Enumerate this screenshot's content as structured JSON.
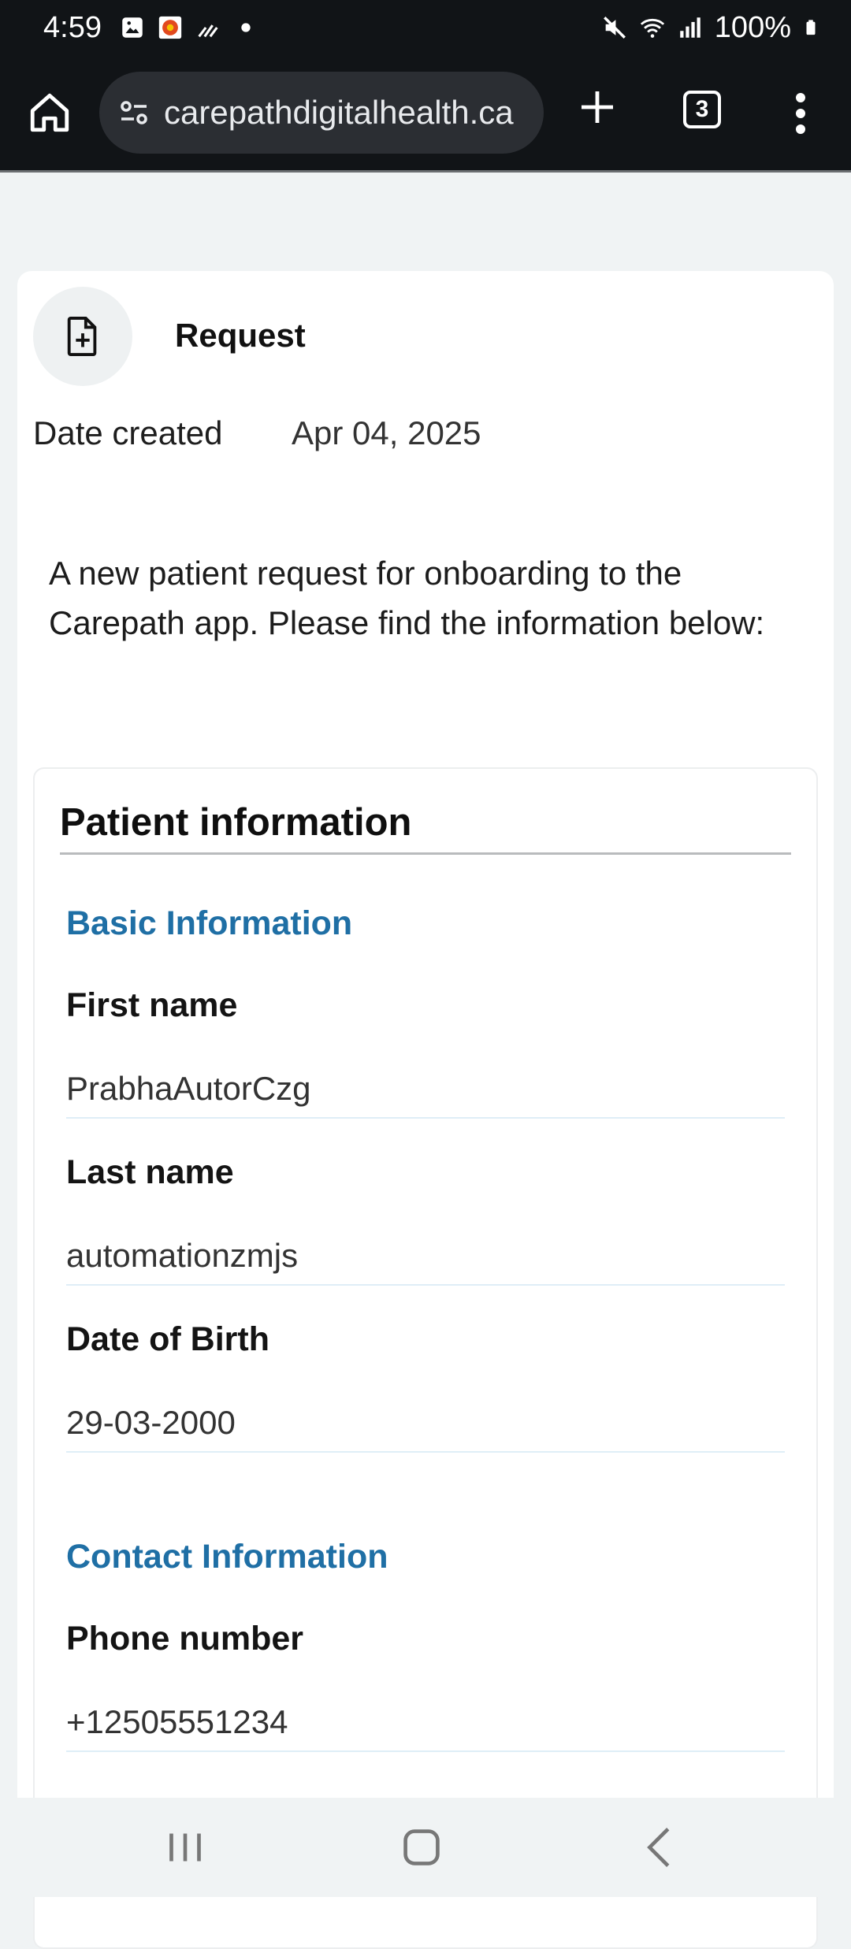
{
  "status_bar": {
    "time": "4:59",
    "battery": "100%",
    "icons": [
      "gallery-icon",
      "app-icon",
      "signal-activity-icon",
      "dot-icon",
      "mute-icon",
      "wifi-icon",
      "cell-signal-icon",
      "battery-icon"
    ]
  },
  "browser": {
    "url": "carepathdigitalhealth.ca",
    "tab_count": "3"
  },
  "request": {
    "title": "Request",
    "date_label": "Date created",
    "date_value": "Apr 04, 2025",
    "intro": "A new patient request for onboarding to the Carepath app. Please find the information below:"
  },
  "patient": {
    "title": "Patient information",
    "basic_title": "Basic Information",
    "first_name_label": "First name",
    "first_name": "PrabhaAutorCzg",
    "last_name_label": "Last name",
    "last_name": "automationzmjs",
    "dob_label": "Date of Birth",
    "dob": "29-03-2000",
    "contact_title": "Contact Information",
    "phone_label": "Phone number",
    "phone": "+12505551234"
  },
  "colors": {
    "accent": "#1f6fa5",
    "browser_bg": "#111417",
    "page_bg": "#f0f3f4"
  }
}
